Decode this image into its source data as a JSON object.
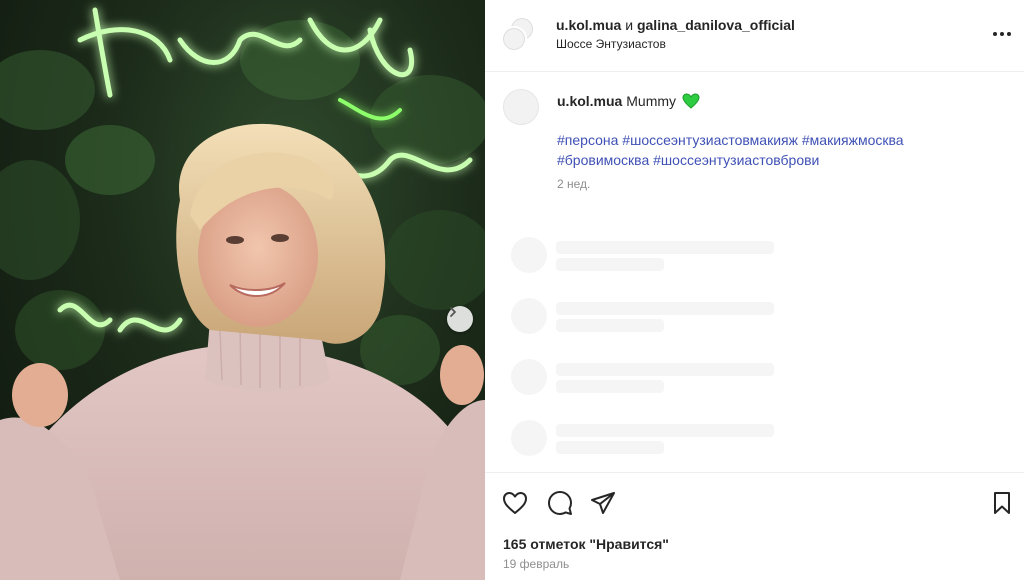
{
  "post": {
    "author1": "u.kol.mua",
    "connector": "и",
    "author2": "galina_danilova_official",
    "location": "Шоссе Энтузиастов"
  },
  "caption": {
    "username": "u.kol.mua",
    "text": "Mummy",
    "emoji": "green-heart",
    "hashtags": [
      "#персона",
      "#шоссеэнтузиастовмакияж",
      "#макияжмосква",
      "#бровимосква",
      "#шоссеэнтузиастовброви"
    ],
    "time_ago": "2 нед."
  },
  "media": {
    "neon_words": [
      "Красоту",
      "Мер",
      "Люб"
    ],
    "neon_color": "#c8ffb0"
  },
  "footer": {
    "likes": "165 отметок \"Нравится\"",
    "date": "19 февраль"
  },
  "icons": {
    "more": "more-options-icon",
    "like": "heart-icon",
    "comment": "comment-icon",
    "share": "share-icon",
    "save": "bookmark-icon",
    "next": "chevron-right-icon"
  },
  "colors": {
    "hashtag": "#3f51b5",
    "muted": "#8e8e8e",
    "text": "#262626",
    "emoji_green": "#2ecc40"
  }
}
